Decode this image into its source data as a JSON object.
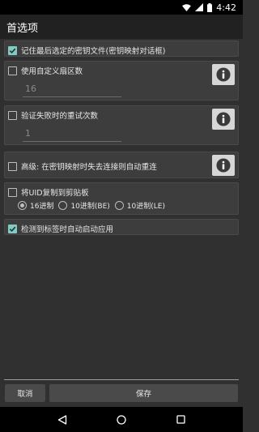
{
  "status_bar": {
    "time": "4:42"
  },
  "action_bar": {
    "title": "首选项"
  },
  "options": {
    "remember_key_file": {
      "label": "记住最后选定的密钥文件(密钥映射对话框)",
      "checked": true
    },
    "custom_sector_count": {
      "label": "使用自定义扇区数",
      "checked": false,
      "value": "16"
    },
    "auth_retry": {
      "label": "验证失败时的重试次数",
      "checked": false,
      "value": "1"
    },
    "auto_reconnect": {
      "label": "高级: 在密钥映射时失去连接则自动重连",
      "checked": false
    },
    "copy_uid": {
      "label": "将UID复制到剪贴板",
      "checked": false,
      "formats": [
        {
          "label": "16进制",
          "selected": true
        },
        {
          "label": "10进制(BE)",
          "selected": false
        },
        {
          "label": "10进制(LE)",
          "selected": false
        }
      ]
    },
    "auto_start_on_tag": {
      "label": "检测到标签时自动启动应用",
      "checked": true
    }
  },
  "buttons": {
    "cancel": "取消",
    "save": "保存"
  },
  "icons": {
    "info": "info-icon",
    "checkbox": "checkbox-icon",
    "back": "back-nav-icon",
    "home": "home-nav-icon",
    "recents": "recents-nav-icon"
  },
  "colors": {
    "accent": "#80cbc4",
    "background": "#303030",
    "card": "#3d3d3d",
    "action_bar": "#212121"
  }
}
